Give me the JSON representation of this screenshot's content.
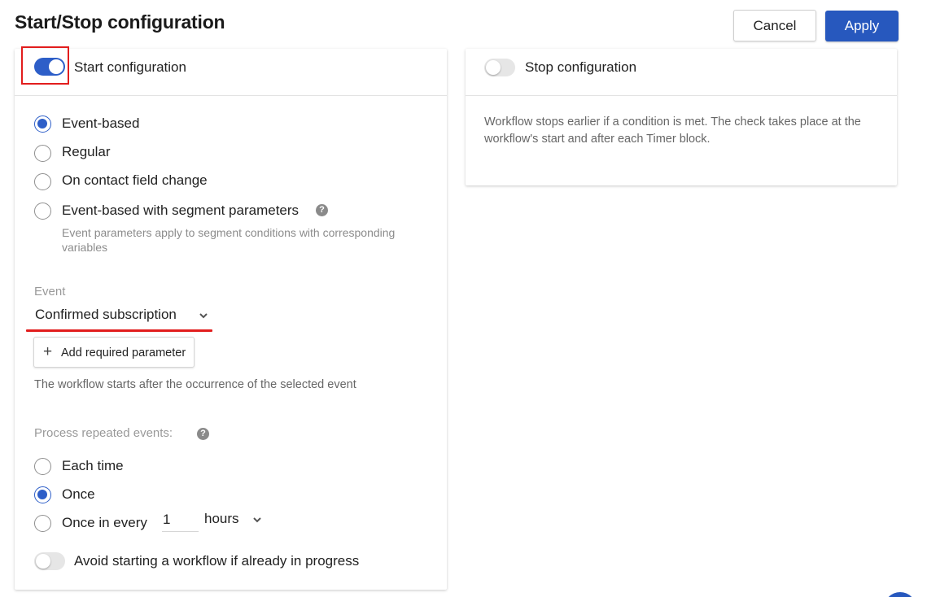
{
  "header": {
    "title": "Start/Stop configuration",
    "cancel_label": "Cancel",
    "apply_label": "Apply"
  },
  "start": {
    "toggle_on": true,
    "label": "Start configuration",
    "trigger_options": [
      {
        "label": "Event-based",
        "checked": true
      },
      {
        "label": "Regular",
        "checked": false
      },
      {
        "label": "On contact field change",
        "checked": false
      },
      {
        "label": "Event-based with segment parameters",
        "checked": false
      }
    ],
    "segment_hint": "Event parameters apply to segment conditions with corresponding variables",
    "event_label": "Event",
    "event_value": "Confirmed subscription",
    "add_param_label": "Add required parameter",
    "event_description": "The workflow starts after the occurrence of the selected event",
    "repeat_label": "Process repeated events:",
    "repeat_options": [
      {
        "label": "Each time",
        "checked": false
      },
      {
        "label": "Once",
        "checked": true
      },
      {
        "label": "Once in every",
        "checked": false
      }
    ],
    "interval_value": "1",
    "interval_unit": "hours",
    "avoid_label": "Avoid starting a workflow if already in progress",
    "avoid_on": false
  },
  "stop": {
    "toggle_on": false,
    "label": "Stop configuration",
    "description": "Workflow stops earlier if a condition is met. The check takes place at the workflow's start and after each Timer block."
  },
  "colors": {
    "accent": "#2d5ec8",
    "apply_button": "#2758be",
    "highlight": "#e21d1d"
  }
}
